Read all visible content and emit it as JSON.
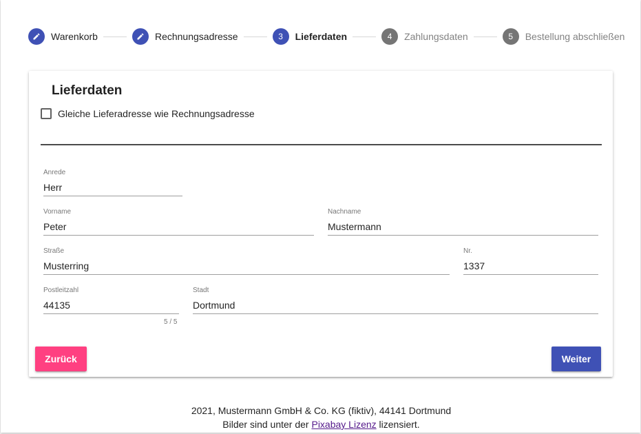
{
  "stepper": {
    "steps": [
      {
        "number": "",
        "label": "Warenkorb",
        "state": "done"
      },
      {
        "number": "",
        "label": "Rechnungsadresse",
        "state": "done"
      },
      {
        "number": "3",
        "label": "Lieferdaten",
        "state": "current"
      },
      {
        "number": "4",
        "label": "Zahlungsdaten",
        "state": "todo"
      },
      {
        "number": "5",
        "label": "Bestellung abschließen",
        "state": "todo"
      }
    ]
  },
  "card": {
    "title": "Lieferdaten",
    "same_address_label": "Gleiche Lieferadresse wie Rechnungsadresse",
    "same_address_checked": false
  },
  "form": {
    "anrede": {
      "label": "Anrede",
      "value": "Herr"
    },
    "vorname": {
      "label": "Vorname",
      "value": "Peter"
    },
    "nachname": {
      "label": "Nachname",
      "value": "Mustermann"
    },
    "strasse": {
      "label": "Straße",
      "value": "Musterring"
    },
    "nr": {
      "label": "Nr.",
      "value": "1337"
    },
    "plz": {
      "label": "Postleitzahl",
      "value": "44135",
      "counter": "5 / 5"
    },
    "stadt": {
      "label": "Stadt",
      "value": "Dortmund"
    }
  },
  "buttons": {
    "back": "Zurück",
    "next": "Weiter"
  },
  "colors": {
    "primary": "#3f51b5",
    "accent": "#ff4081",
    "inactive_step": "#757575"
  },
  "footer": {
    "line1": "2021, Mustermann GmbH & Co. KG (fiktiv), 44141 Dortmund",
    "line2_prefix": "Bilder sind unter der ",
    "line2_link": "Pixabay Lizenz",
    "line2_suffix": " lizensiert."
  }
}
